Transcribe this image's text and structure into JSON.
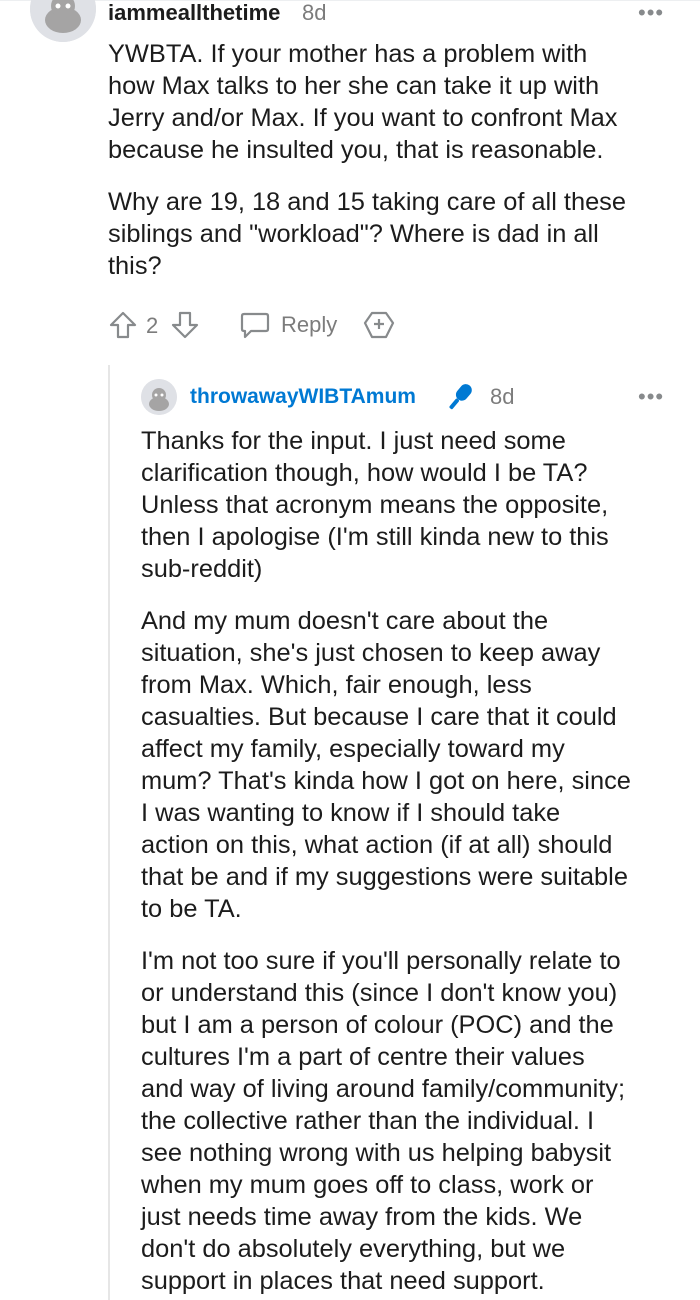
{
  "comment": {
    "username": "iammeallthetime",
    "timestamp": "8d",
    "more_label": "•••",
    "paragraphs": [
      "YWBTA. If your mother has a problem with\nhow Max talks to her she can take it up with\nJerry and/or Max. If you want to confront Max\nbecause he insulted you, that is reasonable.",
      "Why are 19, 18 and 15 taking care of all these\nsiblings and \"workload\"? Where is dad in all\nthis?"
    ],
    "vote_count": "2",
    "reply_label": "Reply",
    "icons": [
      "avatar-icon",
      "upvote-icon",
      "downvote-icon",
      "reply-icon",
      "award-icon",
      "more-icon"
    ]
  },
  "reply": {
    "username": "throwawayWIBTAmum",
    "badge_icon": "microphone-icon",
    "timestamp": "8d",
    "more_label": "•••",
    "username_color": "#0079d3",
    "badge_color": "#0079d3",
    "paragraphs": [
      "Thanks for the input. I just need some\nclarification though, how would I be TA?\nUnless that acronym means the opposite,\nthen I apologise (I'm still kinda new to this\nsub-reddit)",
      "And my mum doesn't care about the\nsituation, she's just chosen to keep away\nfrom Max. Which, fair enough, less\ncasualties. But because I care that it could\naffect my family, especially toward my\nmum? That's kinda how I got on here, since\nI was wanting to know if I should take\naction on this, what action (if at all) should\nthat be and if my suggestions were suitable\nto be TA.",
      "I'm not too sure if you'll personally relate to\nor understand this (since I don't know you)\nbut I am a person of colour (POC) and the\ncultures I'm a part of centre their values\nand way of living around family/community;\nthe collective rather than the individual. I\nsee nothing wrong with us helping babysit\nwhen my mum goes off to class, work or\njust needs time away from the kids. We\ndon't do absolutely everything, but we\nsupport in places that need support."
    ]
  }
}
